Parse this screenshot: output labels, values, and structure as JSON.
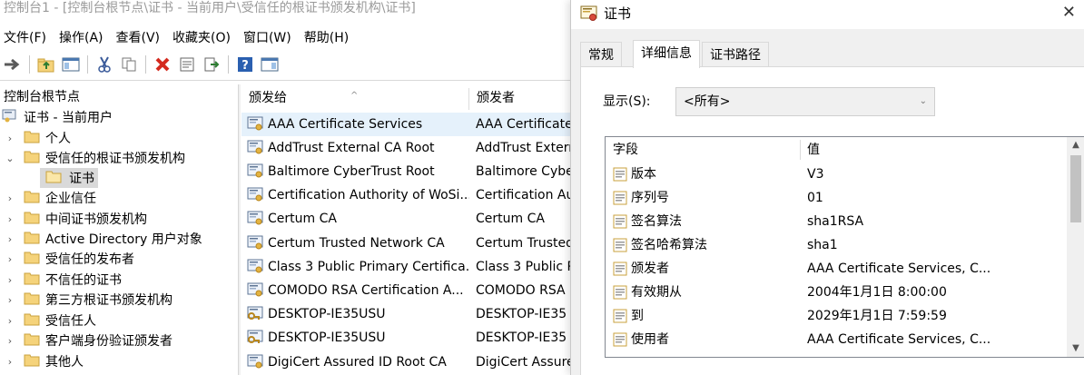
{
  "mmc": {
    "window_title": "控制台1 - [控制台根节点\\证书 - 当前用户\\受信任的根证书颁发机构\\证书]",
    "menu": [
      "文件(F)",
      "操作(A)",
      "查看(V)",
      "收藏夹(O)",
      "窗口(W)",
      "帮助(H)"
    ],
    "toolbar_icons": [
      "back-arrow-icon",
      "up-folder-icon",
      "show-tree-icon",
      "cut-icon",
      "copy-icon",
      "delete-icon",
      "properties-icon",
      "export-icon",
      "help-icon",
      "action-pane-icon"
    ],
    "tree": {
      "root": "控制台根节点",
      "store": "证书 - 当前用户",
      "items": [
        {
          "label": "个人",
          "expanded": false
        },
        {
          "label": "受信任的根证书颁发机构",
          "expanded": true,
          "children": [
            "证书"
          ]
        },
        {
          "label": "企业信任",
          "expanded": false
        },
        {
          "label": "中间证书颁发机构",
          "expanded": false
        },
        {
          "label": "Active Directory 用户对象",
          "expanded": false
        },
        {
          "label": "受信任的发布者",
          "expanded": false
        },
        {
          "label": "不信任的证书",
          "expanded": false
        },
        {
          "label": "第三方根证书颁发机构",
          "expanded": false
        },
        {
          "label": "受信任人",
          "expanded": false
        },
        {
          "label": "客户端身份验证颁发者",
          "expanded": false
        },
        {
          "label": "其他人",
          "expanded": false
        }
      ]
    },
    "list": {
      "columns": [
        "颁发给",
        "颁发者"
      ],
      "rows": [
        {
          "issued_to": "AAA Certificate Services",
          "issued_by": "AAA Certificate",
          "highlighted": true
        },
        {
          "issued_to": "AddTrust External CA Root",
          "issued_by": "AddTrust Extern"
        },
        {
          "issued_to": "Baltimore CyberTrust Root",
          "issued_by": "Baltimore Cybe"
        },
        {
          "issued_to": "Certification Authority of WoSi...",
          "issued_by": "Certification Au"
        },
        {
          "issued_to": "Certum CA",
          "issued_by": "Certum CA"
        },
        {
          "issued_to": "Certum Trusted Network CA",
          "issued_by": "Certum Trusted"
        },
        {
          "issued_to": "Class 3 Public Primary Certifica...",
          "issued_by": "Class 3 Public P"
        },
        {
          "issued_to": "COMODO RSA Certification A...",
          "issued_by": "COMODO RSA"
        },
        {
          "issued_to": "DESKTOP-IE35USU",
          "issued_by": "DESKTOP-IE35"
        },
        {
          "issued_to": "DESKTOP-IE35USU",
          "issued_by": "DESKTOP-IE35"
        },
        {
          "issued_to": "DigiCert Assured ID Root CA",
          "issued_by": "DigiCert Assure"
        }
      ]
    }
  },
  "dialog": {
    "title": "证书",
    "close_glyph": "✕",
    "tabs": [
      "常规",
      "详细信息",
      "证书路径"
    ],
    "active_tab": 1,
    "show_label": "显示(S):",
    "show_value": "<所有>",
    "fields_columns": [
      "字段",
      "值"
    ],
    "fields": [
      {
        "name": "版本",
        "value": "V3"
      },
      {
        "name": "序列号",
        "value": "01"
      },
      {
        "name": "签名算法",
        "value": "sha1RSA"
      },
      {
        "name": "签名哈希算法",
        "value": "sha1"
      },
      {
        "name": "颁发者",
        "value": "AAA Certificate Services, C..."
      },
      {
        "name": "有效期从",
        "value": "2004年1月1日 8:00:00"
      },
      {
        "name": "到",
        "value": "2029年1月1日 7:59:59"
      },
      {
        "name": "使用者",
        "value": "AAA Certificate Services, C..."
      }
    ]
  },
  "colors": {
    "selection": "#e5f1fb",
    "tree_selected": "#d9d9d9",
    "folder": "#f5d37b",
    "delete_red": "#d42a1e",
    "help_blue": "#2a5fb0"
  }
}
